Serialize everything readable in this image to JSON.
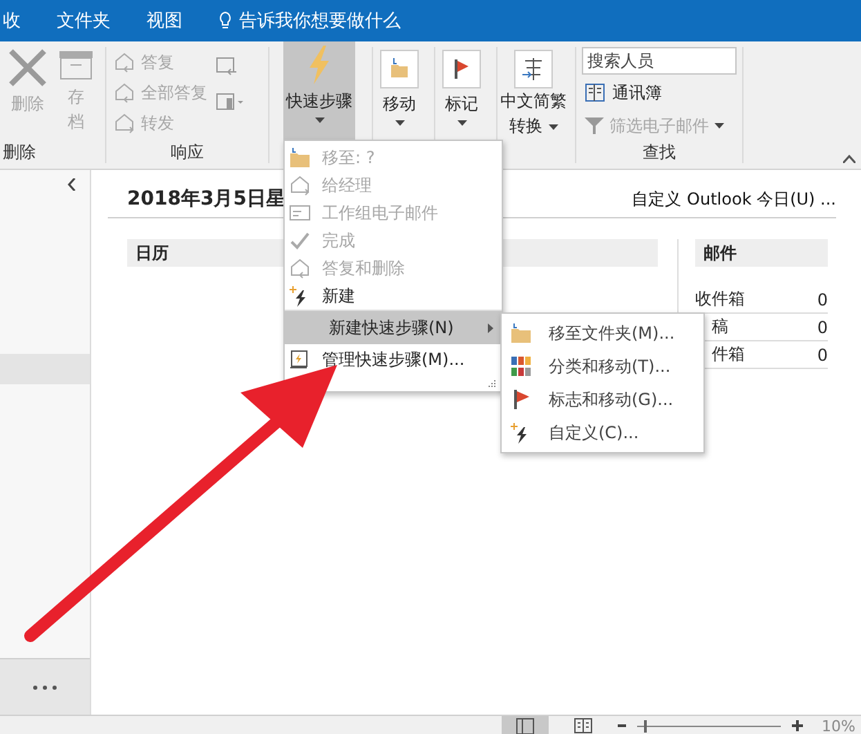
{
  "menu_tabs": [
    {
      "label": "收"
    },
    {
      "label": "文件夹"
    },
    {
      "label": "视图"
    }
  ],
  "tell_me": "告诉我你想要做什么",
  "ribbon": {
    "delete_group": {
      "label": "删除",
      "buttons": [
        {
          "label": "删除",
          "disabled": true
        },
        {
          "label": "存档",
          "disabled": true
        }
      ]
    },
    "respond_group": {
      "label": "响应",
      "items": [
        {
          "label": "答复",
          "disabled": true
        },
        {
          "label": "全部答复",
          "disabled": true
        },
        {
          "label": "转发",
          "disabled": true
        }
      ]
    },
    "quick_steps": {
      "label": "快速步骤",
      "selected": true
    },
    "move": {
      "label": "移动"
    },
    "tags": {
      "label": "标记"
    },
    "convert": {
      "lines": [
        "中文简繁",
        "转换"
      ]
    },
    "find_group": {
      "label": "查找",
      "search": {
        "placeholder": "搜索人员"
      },
      "address_book": "通讯簿",
      "filter": {
        "label": "筛选电子邮件",
        "disabled": true
      }
    }
  },
  "today": {
    "date": "2018年3月5日星",
    "customize": "自定义 Outlook 今日(U) ...",
    "calendar": "日历",
    "mail": {
      "title": "邮件",
      "rows": [
        {
          "name": "收件箱",
          "count": "0"
        },
        {
          "name": "稿",
          "count": "0"
        },
        {
          "name": "件箱",
          "count": "0"
        }
      ]
    }
  },
  "quick_menu": [
    {
      "kind": "folder",
      "label": "移至: ?",
      "disabled": true,
      "selected": false
    },
    {
      "kind": "forward",
      "label": "给经理",
      "disabled": true,
      "selected": false
    },
    {
      "kind": "card",
      "label": "工作组电子邮件",
      "disabled": true,
      "selected": false
    },
    {
      "kind": "check",
      "label": "完成",
      "disabled": true,
      "selected": false
    },
    {
      "kind": "reply",
      "label": "答复和删除",
      "disabled": true,
      "selected": false
    },
    {
      "kind": "bolt",
      "label": "新建",
      "disabled": false,
      "selected": false
    },
    {
      "kind": "submenu",
      "label": "新建快速步骤(N)",
      "disabled": false,
      "selected": true
    },
    {
      "kind": "manage",
      "label": "管理快速步骤(M)...",
      "disabled": false,
      "selected": false
    }
  ],
  "sub_menu": [
    {
      "kind": "folder",
      "label": "移至文件夹(M)..."
    },
    {
      "kind": "grid",
      "label": "分类和移动(T)..."
    },
    {
      "kind": "flag",
      "label": "标志和移动(G)..."
    },
    {
      "kind": "bolt",
      "label": "自定义(C)..."
    }
  ],
  "status_bar": {
    "zoom": "10%",
    "level": 0.05
  }
}
